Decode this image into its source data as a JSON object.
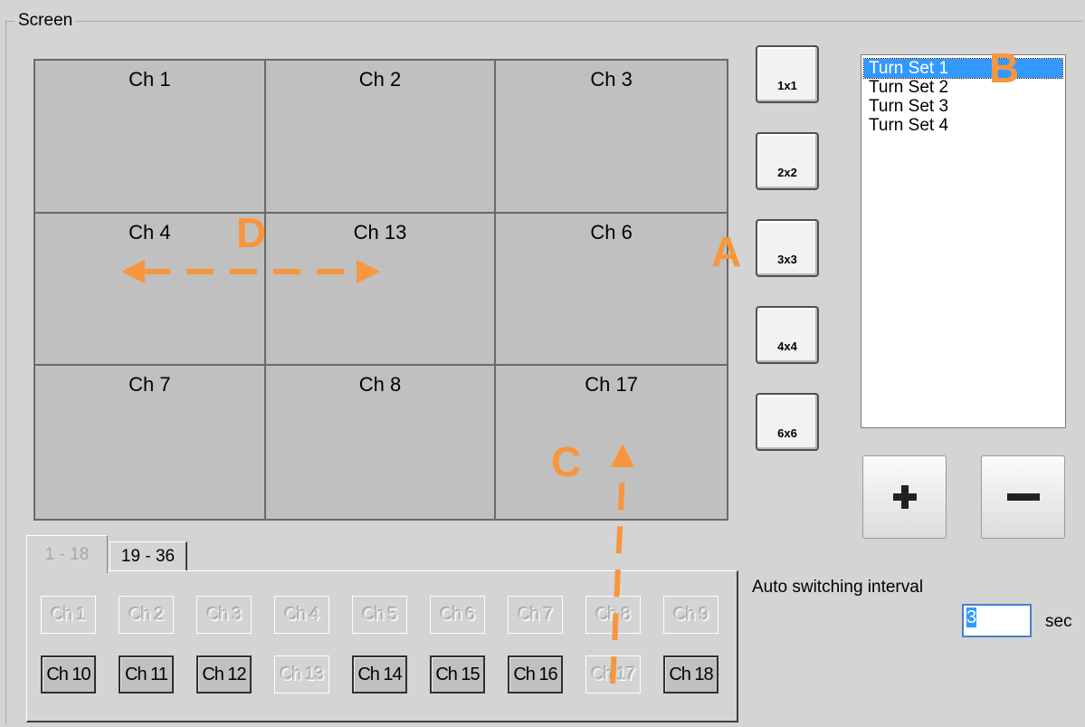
{
  "group_title": "Screen",
  "grid": [
    "Ch 1",
    "Ch 2",
    "Ch 3",
    "Ch 4",
    "Ch 13",
    "Ch 6",
    "Ch 7",
    "Ch 8",
    "Ch 17"
  ],
  "layout_buttons": [
    "1x1",
    "2x2",
    "3x3",
    "4x4",
    "6x6"
  ],
  "turn_sets": {
    "items": [
      "Turn Set  1",
      "Turn Set  2",
      "Turn Set  3",
      "Turn Set  4"
    ],
    "selected": "Turn Set  1"
  },
  "add_button": "+",
  "remove_button": "−",
  "tabs": [
    {
      "label": "1 - 18",
      "active": true
    },
    {
      "label": "19 - 36",
      "active": false
    }
  ],
  "channel_buttons": {
    "row1": [
      "Ch 1",
      "Ch 2",
      "Ch 3",
      "Ch 4",
      "Ch 5",
      "Ch 6",
      "Ch 7",
      "Ch 8",
      "Ch 9"
    ],
    "row2": [
      "Ch 10",
      "Ch 11",
      "Ch 12",
      "Ch 13",
      "Ch 14",
      "Ch 15",
      "Ch 16",
      "Ch 17",
      "Ch 18"
    ],
    "disabled": [
      "Ch 1",
      "Ch 2",
      "Ch 3",
      "Ch 4",
      "Ch 5",
      "Ch 6",
      "Ch 7",
      "Ch 8",
      "Ch 9",
      "Ch 13",
      "Ch 17"
    ]
  },
  "auto_switching": {
    "label": "Auto switching interval",
    "value": "3",
    "unit": "sec"
  },
  "annotations": {
    "A": "A",
    "B": "B",
    "C": "C",
    "D": "D",
    "color": "#f7963c"
  }
}
